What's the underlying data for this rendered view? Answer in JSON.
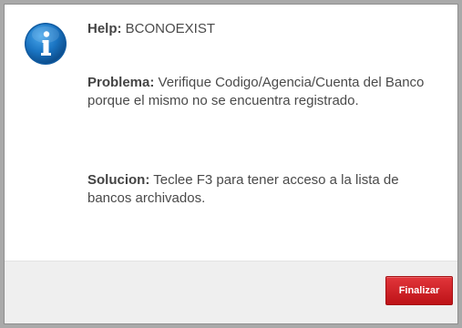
{
  "dialog": {
    "icon": "info-icon",
    "help": {
      "label": "Help:",
      "code": "BCONOEXIST"
    },
    "problema": {
      "label": "Problema:",
      "text": "Verifique Codigo/Agencia/Cuenta del Banco porque el mismo no se encuentra registrado."
    },
    "solucion": {
      "label": "Solucion:",
      "text": "Teclee F3 para tener acceso a la lista de bancos archivados."
    },
    "finalizar_label": "Finalizar"
  },
  "colors": {
    "accent": "#d0232a",
    "icon_blue": "#1a74c2"
  }
}
